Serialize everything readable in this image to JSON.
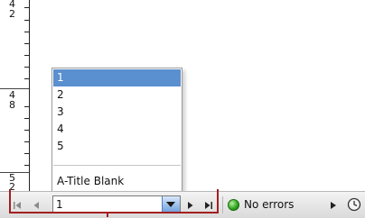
{
  "ruler": {
    "labels": [
      {
        "top": "4",
        "bottom": "2"
      },
      {
        "top": "4",
        "bottom": "8"
      },
      {
        "top": "5",
        "bottom": "2"
      }
    ]
  },
  "popup": {
    "items": [
      "1",
      "2",
      "3",
      "4",
      "5"
    ],
    "selected_index": 0,
    "footer_item": "A-Title Blank"
  },
  "bottombar": {
    "page_value": "1",
    "status_text": "No errors",
    "colors": {
      "selection": "#5a8fd0",
      "status_ok": "#2aa21a",
      "highlight_outline": "#a32020"
    },
    "icons": {
      "first": "first-page-icon",
      "prev": "previous-page-icon",
      "dropdown": "chevron-down-icon",
      "next": "next-page-icon",
      "last": "last-page-icon",
      "status": "status-ok-icon",
      "status_menu": "status-menu-arrow-icon",
      "preflight": "preflight-clock-icon"
    }
  }
}
